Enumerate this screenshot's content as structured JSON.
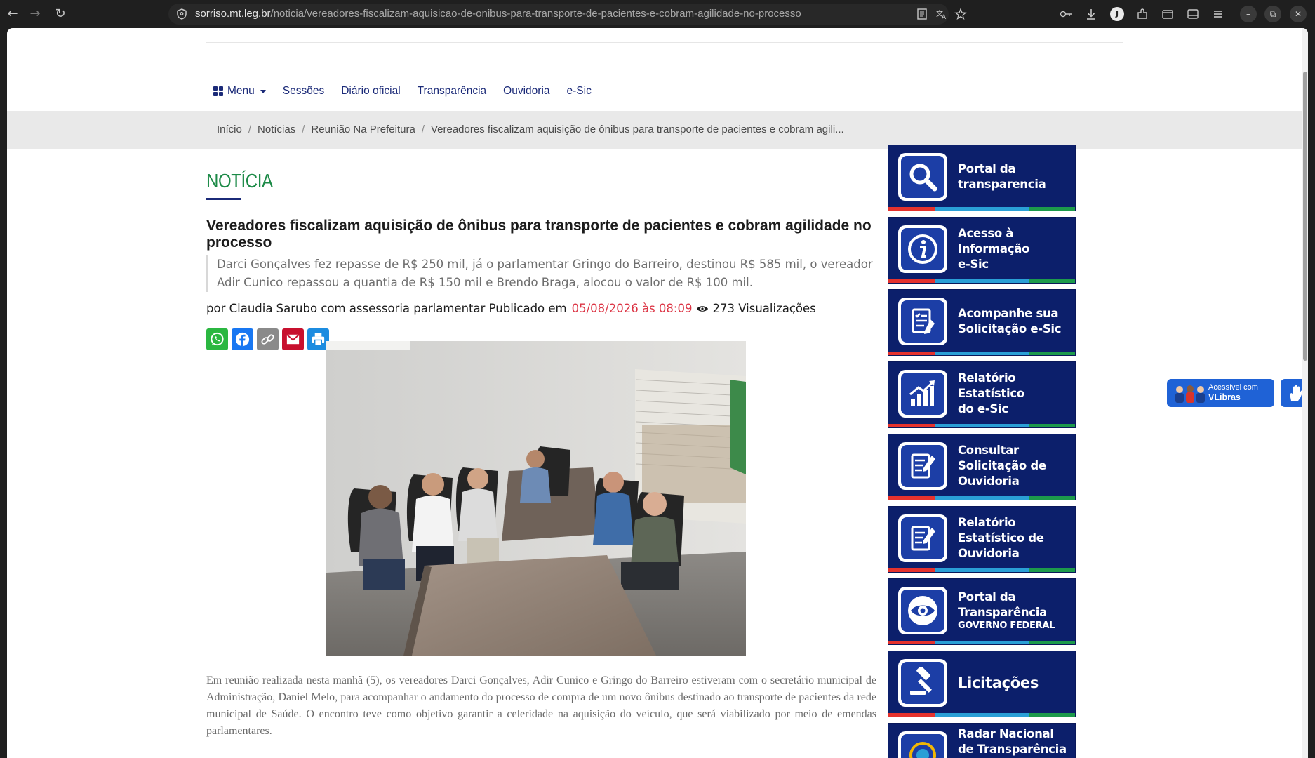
{
  "browser": {
    "url_domain": "sorriso.mt.leg.br",
    "url_path": "/noticia/vereadores-fiscalizam-aquisicao-de-onibus-para-transporte-de-pacientes-e-cobram-agilidade-no-processo",
    "profile_initial": "J"
  },
  "nav": {
    "menu_label": "Menu",
    "items": [
      "Sessões",
      "Diário oficial",
      "Transparência",
      "Ouvidoria",
      "e-Sic"
    ]
  },
  "breadcrumb": [
    "Início",
    "Notícias",
    "Reunião Na Prefeitura",
    "Vereadores fiscalizam aquisição de ônibus para transporte de pacientes e cobram agili..."
  ],
  "article": {
    "section_title": "NOTÍCIA",
    "headline": "Vereadores fiscalizam aquisição de ônibus para transporte de pacientes e cobram agilidade no processo",
    "lead": "Darci Gonçalves fez repasse de R$ 250 mil, já o parlamentar Gringo do Barreiro, destinou R$ 585 mil, o vereador Adir Cunico repassou a quantia de R$ 150 mil e Brendo Braga, alocou o valor de R$ 100 mil.",
    "byline_prefix": "por Claudia Sarubo com assessoria parlamentar Publicado em",
    "date": "05/08/2026 às 08:09",
    "views": "273 Visualizações",
    "body": "Em reunião realizada nesta manhã (5), os vereadores Darci Gonçalves, Adir Cunico e Gringo do Barreiro estiveram com o secretário municipal de Administração, Daniel Melo, para acompanhar o andamento do processo de compra de um novo ônibus destinado ao transporte de pacientes da rede municipal de Saúde. O encontro teve como objetivo garantir a celeridade na aquisição do veículo, que será viabilizado por meio de emendas parlamentares."
  },
  "share_buttons": [
    {
      "name": "whatsapp",
      "color": "#2bb741"
    },
    {
      "name": "facebook",
      "color": "#1877f2"
    },
    {
      "name": "copy-link",
      "color": "#8a8a8a"
    },
    {
      "name": "email",
      "color": "#c8102e"
    },
    {
      "name": "print",
      "color": "#1c8ce0"
    }
  ],
  "sidebar": {
    "banners": [
      {
        "lines": [
          "Portal da",
          "transparencia"
        ],
        "icon": "magnifier-icon"
      },
      {
        "lines": [
          "Acesso à",
          "Informação",
          "e-Sic"
        ],
        "icon": "info-icon"
      },
      {
        "lines": [
          "Acompanhe sua",
          "Solicitação e-Sic"
        ],
        "icon": "checklist-icon"
      },
      {
        "lines": [
          "Relatório",
          "Estatístico",
          "do e-Sic"
        ],
        "icon": "chart-icon"
      },
      {
        "lines": [
          "Consultar",
          "Solicitação de",
          "Ouvidoria"
        ],
        "icon": "document-edit-icon"
      },
      {
        "lines": [
          "Relatório",
          "Estatístico de",
          "Ouvidoria"
        ],
        "icon": "document-edit-icon"
      },
      {
        "lines": [
          "Portal da",
          "Transparência"
        ],
        "sub": "GOVERNO FEDERAL",
        "icon": "eye-emblem-icon"
      },
      {
        "lines": [
          "Licitações"
        ],
        "icon": "gavel-icon"
      },
      {
        "lines": [
          "Radar Nacional",
          "de Transparência"
        ],
        "icon": "radar-icon"
      }
    ],
    "stripe_colors": [
      "#e5322d",
      "#2a9fd6",
      "#2a9fd6",
      "#1c9a4b"
    ]
  },
  "vlibras": {
    "line1": "Acessível com",
    "line2": "VLibras"
  }
}
